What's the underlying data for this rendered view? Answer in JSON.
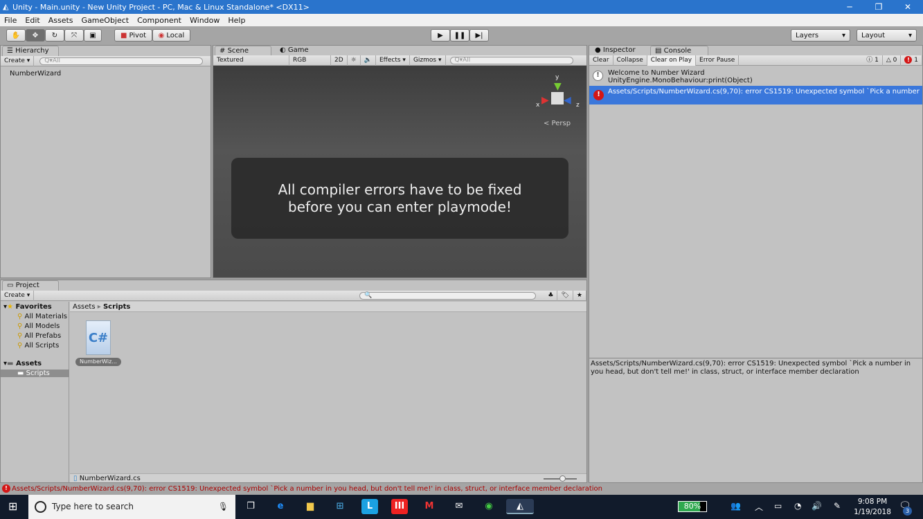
{
  "window": {
    "title": "Unity - Main.unity - New Unity Project - PC, Mac & Linux Standalone* <DX11>",
    "minimize": "─",
    "restore": "❐",
    "close": "✕"
  },
  "menu": [
    "File",
    "Edit",
    "Assets",
    "GameObject",
    "Component",
    "Window",
    "Help"
  ],
  "toolbar": {
    "pivot": "Pivot",
    "local": "Local",
    "layers": "Layers",
    "layout": "Layout"
  },
  "hierarchy": {
    "tab": "Hierarchy",
    "create": "Create",
    "search_placeholder": "Q▾All",
    "items": [
      "NumberWizard"
    ]
  },
  "scene": {
    "tab_scene": "Scene",
    "tab_game": "Game",
    "shading": "Textured",
    "render_mode": "RGB",
    "mode_2d": "2D",
    "effects": "Effects",
    "gizmos": "Gizmos",
    "search_placeholder": "Q▾All",
    "persp": "< Persp",
    "axis_y": "y",
    "axis_x": "x",
    "axis_z": "z",
    "overlay_line1": "All compiler errors have to be fixed",
    "overlay_line2": "before you can enter playmode!"
  },
  "inspector": {
    "tab": "Inspector"
  },
  "console": {
    "tab": "Console",
    "buttons": [
      "Clear",
      "Collapse",
      "Clear on Play",
      "Error Pause"
    ],
    "count_info": "1",
    "count_warn": "0",
    "count_error": "1",
    "entries": [
      {
        "type": "info",
        "line1": "Welcome to Number Wizard",
        "line2": "UnityEngine.MonoBehaviour:print(Object)"
      },
      {
        "type": "error",
        "line1": "Assets/Scripts/NumberWizard.cs(9,70): error CS1519: Unexpected symbol `Pick a number",
        "line2": ""
      }
    ],
    "detail": "Assets/Scripts/NumberWizard.cs(9,70): error CS1519: Unexpected symbol `Pick a number in you head, but don't tell me!' in class, struct, or interface member declaration"
  },
  "project": {
    "tab": "Project",
    "create": "Create",
    "favorites": "Favorites",
    "favorite_items": [
      "All Materials",
      "All Models",
      "All Prefabs",
      "All Scripts"
    ],
    "assets": "Assets",
    "asset_folders": [
      "Scripts"
    ],
    "breadcrumb": [
      "Assets",
      "Scripts"
    ],
    "files": [
      {
        "name": "NumberWiz...",
        "icon": "C#"
      }
    ],
    "selected_file": "NumberWizard.cs"
  },
  "status": {
    "message": "Assets/Scripts/NumberWizard.cs(9,70): error CS1519: Unexpected symbol `Pick a number in you head, but don't tell me!' in class, struct, or interface member declaration"
  },
  "taskbar": {
    "search_placeholder": "Type here to search",
    "battery": "80%",
    "time": "9:08 PM",
    "date": "1/19/2018",
    "notifications": "3"
  }
}
